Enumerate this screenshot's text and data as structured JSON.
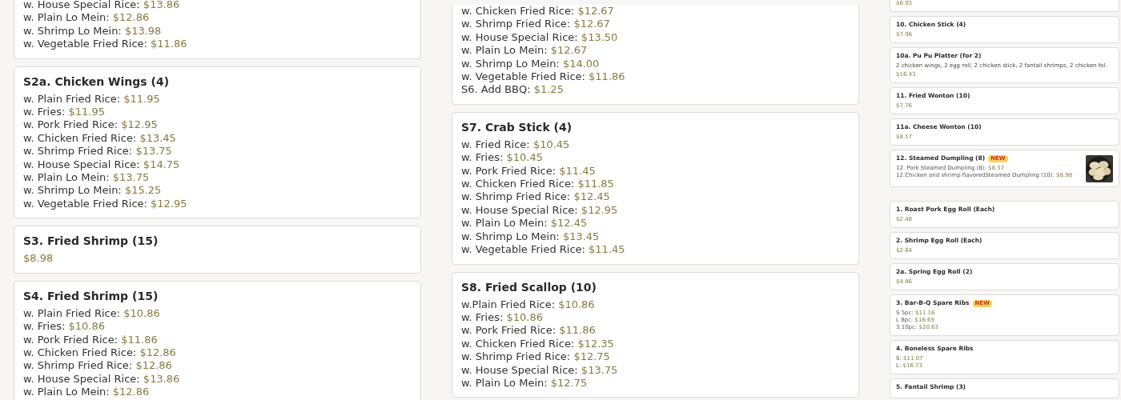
{
  "columns": [
    {
      "kind": "full",
      "cards": [
        {
          "cut_top": true,
          "lines": [
            {
              "label": "w. House Special Rice:",
              "price": "$13.86"
            },
            {
              "label": "w. Plain Lo Mein:",
              "price": "$12.86"
            },
            {
              "label": "w. Shrimp Lo Mein:",
              "price": "$13.98"
            },
            {
              "label": "w. Vegetable Fried Rice:",
              "price": "$11.86"
            }
          ]
        },
        {
          "title": "S2a. Chicken Wings (4)",
          "lines": [
            {
              "label": "w. Plain Fried Rice:",
              "price": "$11.95"
            },
            {
              "label": "w. Fries:",
              "price": "$11.95"
            },
            {
              "label": "w. Pork Fried Rice:",
              "price": "$12.95"
            },
            {
              "label": "w. Chicken Fried Rice:",
              "price": "$13.45"
            },
            {
              "label": "w. Shrimp Fried Rice:",
              "price": "$13.75"
            },
            {
              "label": "w. House Special Rice:",
              "price": "$14.75"
            },
            {
              "label": "w. Plain Lo Mein:",
              "price": "$13.75"
            },
            {
              "label": "w. Shrimp Lo Mein:",
              "price": "$15.25"
            },
            {
              "label": "w. Vegetable Fried Rice:",
              "price": "$12.95"
            }
          ]
        },
        {
          "title": "S3. Fried Shrimp (15)",
          "price": "$8.98"
        },
        {
          "title": "S4. Fried Shrimp (15)",
          "lines": [
            {
              "label": "w. Plain Fried Rice:",
              "price": "$10.86"
            },
            {
              "label": "w. Fries:",
              "price": "$10.86"
            },
            {
              "label": "w. Pork Fried Rice:",
              "price": "$11.86"
            },
            {
              "label": "w. Chicken Fried Rice:",
              "price": "$12.86"
            },
            {
              "label": "w. Shrimp Fried Rice:",
              "price": "$12.86"
            },
            {
              "label": "w. House Special Rice:",
              "price": "$13.86"
            },
            {
              "label": "w. Plain Lo Mein:",
              "price": "$12.86"
            }
          ]
        }
      ]
    },
    {
      "kind": "full",
      "cards": [
        {
          "cut_top": true,
          "lines": [
            {
              "label": "w. Chicken Fried Rice:",
              "price": "$12.67"
            },
            {
              "label": "w. Shrimp Fried Rice:",
              "price": "$12.67"
            },
            {
              "label": "w. House Special Rice:",
              "price": "$13.50"
            },
            {
              "label": "w. Plain Lo Mein:",
              "price": "$12.67"
            },
            {
              "label": "w. Shrimp Lo Mein:",
              "price": "$14.00"
            },
            {
              "label": "w. Vegetable Fried Rice:",
              "price": "$11.86"
            },
            {
              "label": "S6. Add BBQ:",
              "price": "$1.25"
            }
          ]
        },
        {
          "title": "S7. Crab Stick (4)",
          "lines": [
            {
              "label": "w. Fried Rice:",
              "price": "$10.45"
            },
            {
              "label": "w. Fries:",
              "price": "$10.45"
            },
            {
              "label": "w. Pork Fried Rice:",
              "price": "$11.45"
            },
            {
              "label": "w. Chicken Fried Rice:",
              "price": "$11.85"
            },
            {
              "label": "w. Shrimp Fried Rice:",
              "price": "$12.45"
            },
            {
              "label": "w. House Special Rice:",
              "price": "$12.95"
            },
            {
              "label": "w. Plain Lo Mein:",
              "price": "$12.45"
            },
            {
              "label": "w. Shrimp Lo Mein:",
              "price": "$13.45"
            },
            {
              "label": "w. Vegetable Fried Rice:",
              "price": "$11.45"
            }
          ]
        },
        {
          "title": "S8. Fried Scallop (10)",
          "lines": [
            {
              "label": "w.Plain Fried Rice:",
              "price": "$10.86"
            },
            {
              "label": "w. Fries:",
              "price": "$10.86"
            },
            {
              "label": "w. Pork Fried Rice:",
              "price": "$11.86"
            },
            {
              "label": "w. Chicken Fried Rice:",
              "price": "$12.35"
            },
            {
              "label": "w. Shrimp Fried Rice:",
              "price": "$12.75"
            },
            {
              "label": "w. House Special Rice:",
              "price": "$13.75"
            },
            {
              "label": "w. Plain Lo Mein:",
              "price": "$12.75"
            }
          ]
        }
      ]
    },
    {
      "kind": "compact",
      "cards": [
        {
          "cut_top": true,
          "price": "$6.93"
        },
        {
          "title": "10. Chicken Stick (4)",
          "price": "$7.96"
        },
        {
          "title": "10a. Pu Pu Platter (for 2)",
          "description": "2 chicken wings, 2 egg roll, 2 chicken stick, 2 fantail shrimps, 2 chicken fol.",
          "price": "$16.43"
        },
        {
          "title": "11. Fried Wonton (10)",
          "price": "$7.76"
        },
        {
          "title": "11a. Cheese Wonton (10)",
          "price": "$8.17"
        },
        {
          "title": "12. Steamed Dumpling (8)",
          "badge": "NEW",
          "picture": true,
          "lines": [
            {
              "label": "12. Pork Steamed Dumpling (8):",
              "price": "$8.37"
            },
            {
              "label": "12.Chicken and shrimp flavoredSteamed Dumpling (10):",
              "price": "$8.98"
            }
          ]
        },
        {
          "title": "1. Roast Pork Egg Roll (Each)",
          "price": "$2.48",
          "break_before": true
        },
        {
          "title": "2. Shrimp Egg Roll (Each)",
          "price": "$2.64"
        },
        {
          "title": "2a. Spring Egg Roll (2)",
          "price": "$4.86"
        },
        {
          "title": "3. Bar-B-Q Spare Ribs",
          "badge": "NEW",
          "lines": [
            {
              "label": "S 5pc:",
              "price": "$11.16"
            },
            {
              "label": "L 8pc:",
              "price": "$16.69"
            },
            {
              "label": "3.10pc:",
              "price": "$20.63"
            }
          ]
        },
        {
          "title": "4. Boneless Spare Ribs",
          "lines": [
            {
              "label": "S:",
              "price": "$11.07"
            },
            {
              "label": "L:",
              "price": "$16.73"
            }
          ]
        },
        {
          "title": "5. Fantail Shrimp (3)"
        }
      ]
    }
  ]
}
